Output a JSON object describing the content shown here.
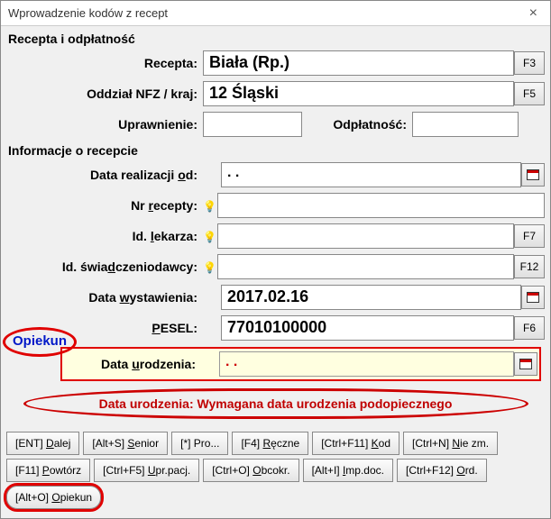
{
  "window": {
    "title": "Wprowadzenie kodów z recept"
  },
  "section1": {
    "title": "Recepta i odpłatność",
    "recepta_label": "Recepta:",
    "recepta_value": "Biała (Rp.)",
    "recepta_key": "F3",
    "oddzial_label": "Oddział NFZ / kraj:",
    "oddzial_value": "12 Śląski",
    "oddzial_key": "F5",
    "uprawnienie_label": "Uprawnienie:",
    "uprawnienie_value": "",
    "odplatnosc_label": "Odpłatność:",
    "odplatnosc_value": ""
  },
  "section2": {
    "title": "Informacje o recepcie",
    "data_realizacji_label": "Data realizacji od:",
    "data_realizacji_value": "   .   .   ",
    "nr_recepty_label": "Nr recepty:",
    "nr_recepty_value": "",
    "id_lekarza_label": "Id. lekarza:",
    "id_lekarza_value": "",
    "id_lekarza_key": "F7",
    "id_swiad_label": "Id. świadczeniodawcy:",
    "id_swiad_value": "",
    "id_swiad_key": "F12",
    "data_wyst_label": "Data wystawienia:",
    "data_wyst_value": "2017.02.16",
    "pesel_label": "PESEL:",
    "pesel_value": "77010100000",
    "pesel_key": "F6",
    "data_urodz_label": "Data urodzenia:",
    "data_urodz_value": "   .   .   "
  },
  "opiekun_label": "Opiekun",
  "warning": "Data urodzenia: Wymagana data urodzenia podopiecznego",
  "buttons": {
    "ent": "[ENT] Dalej",
    "alts": "[Alt+S] Senior",
    "star": "[*] Pro...",
    "f4": "[F4] Ręczne",
    "ctrlf11": "[Ctrl+F11] Kod",
    "ctrln": "[Ctrl+N] Nie zm.",
    "f11": "[F11] Powtórz",
    "ctrlf5": "[Ctrl+F5] Upr.pacj.",
    "ctrlo": "[Ctrl+O] Obcokr.",
    "alti": "[Alt+I] Imp.doc.",
    "ctrlf12": "[Ctrl+F12] Ord.",
    "alto": "[Alt+O] Opiekun"
  }
}
